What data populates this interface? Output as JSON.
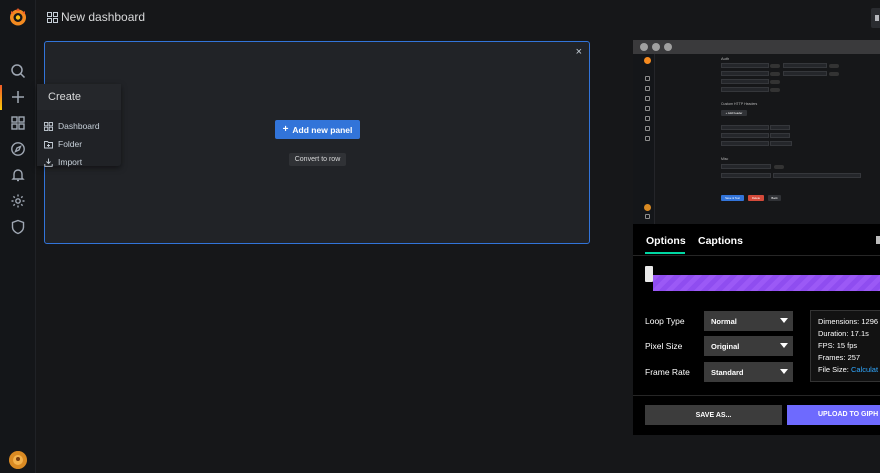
{
  "topbar": {
    "title": "New dashboard"
  },
  "panel": {
    "add_button": "Add new panel",
    "convert_button": "Convert to row",
    "close": "×"
  },
  "create_menu": {
    "header": "Create",
    "items": [
      {
        "label": "Dashboard",
        "icon": "grid-icon"
      },
      {
        "label": "Folder",
        "icon": "folder-plus-icon"
      },
      {
        "label": "Import",
        "icon": "import-icon"
      }
    ]
  },
  "sidebar": {
    "icons": [
      "search-icon",
      "plus-icon",
      "grid-icon",
      "compass-icon",
      "bell-icon",
      "gear-icon",
      "shield-icon"
    ]
  },
  "recorder": {
    "tabs": [
      "Options",
      "Captions"
    ],
    "options": [
      {
        "label": "Loop Type",
        "value": "Normal"
      },
      {
        "label": "Pixel Size",
        "value": "Original"
      },
      {
        "label": "Frame Rate",
        "value": "Standard"
      }
    ],
    "info": {
      "dimensions": "Dimensions: 1296",
      "duration": "Duration: 17.1s",
      "fps": "FPS: 15 fps",
      "frames": "Frames: 257",
      "file_size_label": "File Size:",
      "file_size_link": "Calculat"
    },
    "save_button": "SAVE AS...",
    "upload_button": "UPLOAD TO GIPH",
    "colors": {
      "accent": "#9b59f6",
      "upload": "#6e6afe",
      "tab_underline": "#00d7a3"
    }
  },
  "nested_screenshot": {
    "section_auth": "Auth",
    "section_headers": "Custom HTTP Headers",
    "section_misc": "Misc",
    "add_header": "+ Add header",
    "buttons": [
      "Save & Test",
      "Delete",
      "Back"
    ]
  },
  "colors": {
    "primary": "#3274d9",
    "sidebar_bg": "#141619",
    "page_bg": "#161719"
  }
}
